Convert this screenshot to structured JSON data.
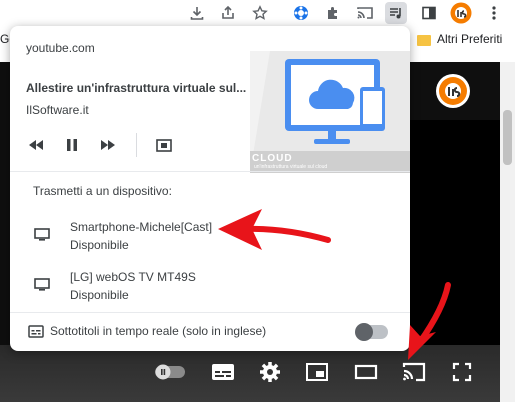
{
  "browser": {
    "toolbar_icons": [
      "download-icon",
      "share-icon",
      "star-icon",
      "extension-colorful-icon",
      "puzzle-icon",
      "cast-icon",
      "media-controls-icon",
      "side-panel-icon",
      "profile-avatar",
      "kebab-menu-icon"
    ],
    "tab_fragment": "Go",
    "bookmark_folder_label": "Altri Preferiti"
  },
  "popup": {
    "origin": "youtube.com",
    "media_title": "Allestire un'infrastruttura virtuale sul...",
    "media_source": "IlSoftware.it",
    "artwork_caption": "CLOUD",
    "artwork_subcaption": "un'infrastruttura virtuale sul cloud",
    "media_controls": [
      "previous-track-icon",
      "pause-icon",
      "next-track-icon",
      "picture-in-picture-icon"
    ],
    "cast_heading": "Trasmetti a un dispositivo:",
    "devices": [
      {
        "name": "Smartphone-Michele[Cast]",
        "status": "Disponibile",
        "icon": "tv-icon"
      },
      {
        "name": "[LG] webOS TV MT49S",
        "status": "Disponibile",
        "icon": "tv-icon"
      }
    ],
    "captions_label": "Sottotitoli in tempo reale (solo in inglese)",
    "captions_enabled": false
  },
  "player": {
    "controls": [
      "autoplay-toggle",
      "subtitles-icon",
      "settings-gear-icon",
      "miniplayer-icon",
      "theater-mode-icon",
      "cast-icon",
      "fullscreen-icon"
    ]
  },
  "colors": {
    "annotation_arrow": "#e8141a",
    "artwork_blue": "#4a8ef0",
    "video_background": "#0f0f0f"
  }
}
